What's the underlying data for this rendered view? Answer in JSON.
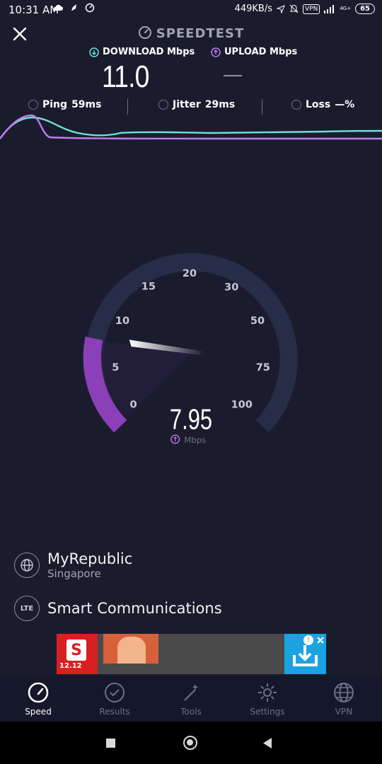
{
  "status_bar": {
    "time": "10:31 AM",
    "net_speed": "449KB/s",
    "vpn": "VPN",
    "network": "4G+",
    "battery": "65"
  },
  "header": {
    "app_title": "SPEEDTEST"
  },
  "results": {
    "download_label": "DOWNLOAD Mbps",
    "download_value": "11.0",
    "upload_label": "UPLOAD Mbps",
    "upload_value": "—"
  },
  "metrics": {
    "ping_label": "Ping",
    "ping_value": "59ms",
    "jitter_label": "Jitter",
    "jitter_value": "29ms",
    "loss_label": "Loss",
    "loss_value": "—%"
  },
  "gauge": {
    "ticks": [
      "0",
      "5",
      "10",
      "15",
      "20",
      "30",
      "50",
      "75",
      "100"
    ],
    "current_value": "7.95",
    "unit": "Mbps"
  },
  "provider": {
    "isp": "MyRepublic",
    "location": "Singapore"
  },
  "server": {
    "name": "Smart Communications",
    "badge": "LTE"
  },
  "ad": {
    "label": "12.12"
  },
  "tabs": [
    {
      "label": "Speed",
      "icon": "speedometer-icon",
      "active": true
    },
    {
      "label": "Results",
      "icon": "check-circle-icon",
      "active": false
    },
    {
      "label": "Tools",
      "icon": "magic-wand-icon",
      "active": false
    },
    {
      "label": "Settings",
      "icon": "gear-icon",
      "active": false
    },
    {
      "label": "VPN",
      "icon": "globe-icon",
      "active": false
    }
  ],
  "colors": {
    "background": "#1a1c2e",
    "download_accent": "#6ee0dd",
    "upload_accent": "#c07cf0",
    "gauge_fill": "#8b3fb8",
    "gauge_track": "#272c48"
  }
}
